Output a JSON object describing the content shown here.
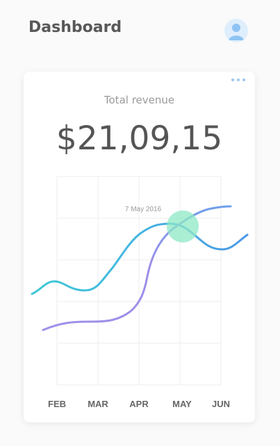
{
  "header": {
    "title": "Dashboard"
  },
  "card": {
    "label": "Total revenue",
    "value": "$21,09,15"
  },
  "icons": {
    "profile": "user-avatar-icon",
    "menu": "more-dots-icon"
  },
  "colors": {
    "teal_series": "#3ec8d6",
    "blue_series": "#4a98e6",
    "purple_series": "#a08ee8",
    "highlight": "#8ee8c6",
    "avatar_bg": "#dfeefc",
    "avatar_fg": "#8fc3f3"
  },
  "chart_data": {
    "type": "line",
    "categories": [
      "FEB",
      "MAR",
      "APR",
      "MAY",
      "JUN"
    ],
    "annotation": "7 May 2016",
    "grid": true,
    "series": [
      {
        "values": [
          null,
          null,
          null,
          null,
          null
        ]
      },
      {
        "values": [
          null,
          null,
          null,
          null,
          null
        ]
      }
    ]
  }
}
